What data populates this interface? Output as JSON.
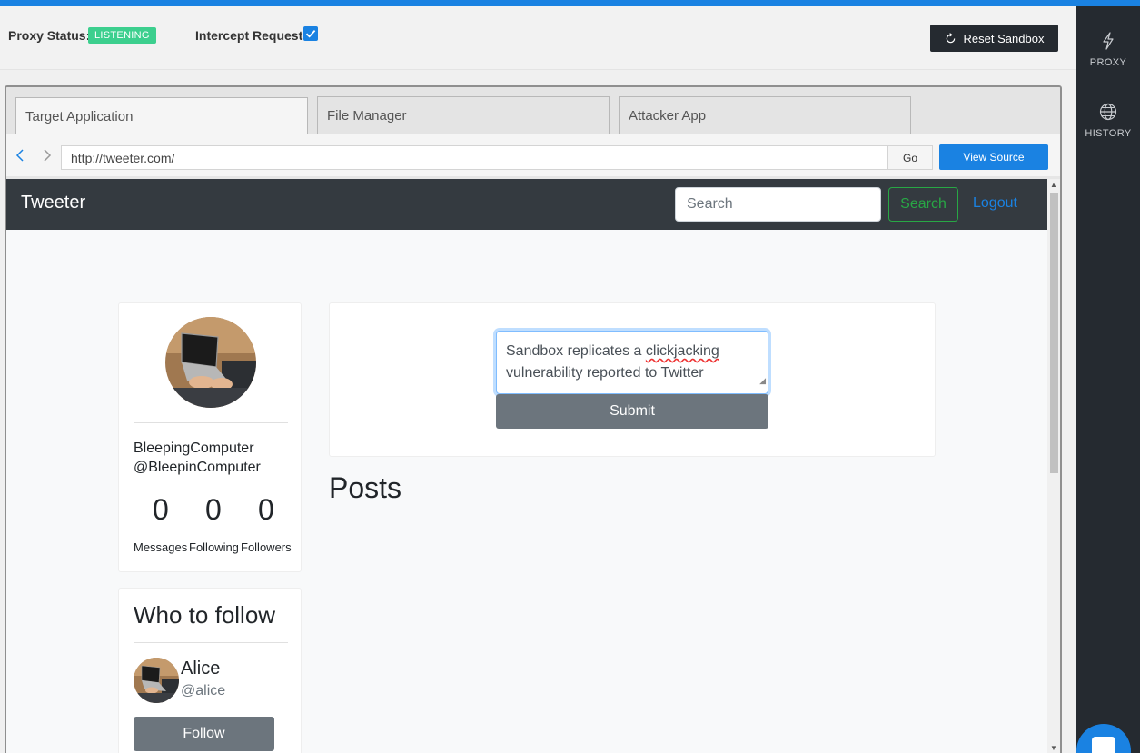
{
  "proxy_header": {
    "status_label": "Proxy Status:",
    "status_value": "LISTENING",
    "status_color": "#3ccf8e",
    "intercept_label": "Intercept Requests",
    "intercept_checked": true,
    "reset_label": "Reset Sandbox"
  },
  "right_sidebar": {
    "items": [
      {
        "label": "PROXY",
        "icon": "lightning-icon"
      },
      {
        "label": "HISTORY",
        "icon": "globe-icon"
      }
    ]
  },
  "browser": {
    "tabs": [
      {
        "label": "Target Application",
        "active": true
      },
      {
        "label": "File Manager",
        "active": false
      },
      {
        "label": "Attacker App",
        "active": false
      }
    ],
    "url": "http://tweeter.com/",
    "go_label": "Go",
    "view_source_label": "View Source"
  },
  "app": {
    "brand": "Tweeter",
    "search_placeholder": "Search",
    "search_button": "Search",
    "logout": "Logout",
    "profile": {
      "name": "BleepingComputer",
      "handle": "@BleepinComputer",
      "stats": [
        {
          "value": "0",
          "label": "Messages"
        },
        {
          "value": "0",
          "label": "Following"
        },
        {
          "value": "0",
          "label": "Followers"
        }
      ]
    },
    "who_to_follow": {
      "title": "Who to follow",
      "users": [
        {
          "name": "Alice",
          "handle": "@alice",
          "button": "Follow"
        }
      ]
    },
    "compose": {
      "text_part1": "Sandbox replicates a ",
      "text_misspelled": "clickjacking",
      "text_part2": " vulnerability reported to Twitter",
      "submit_label": "Submit"
    },
    "posts_heading": "Posts"
  },
  "colors": {
    "accent": "#1a82e2",
    "dark": "#252a30",
    "navbar": "#343a40",
    "success": "#28a745",
    "secondary": "#6c757d"
  }
}
